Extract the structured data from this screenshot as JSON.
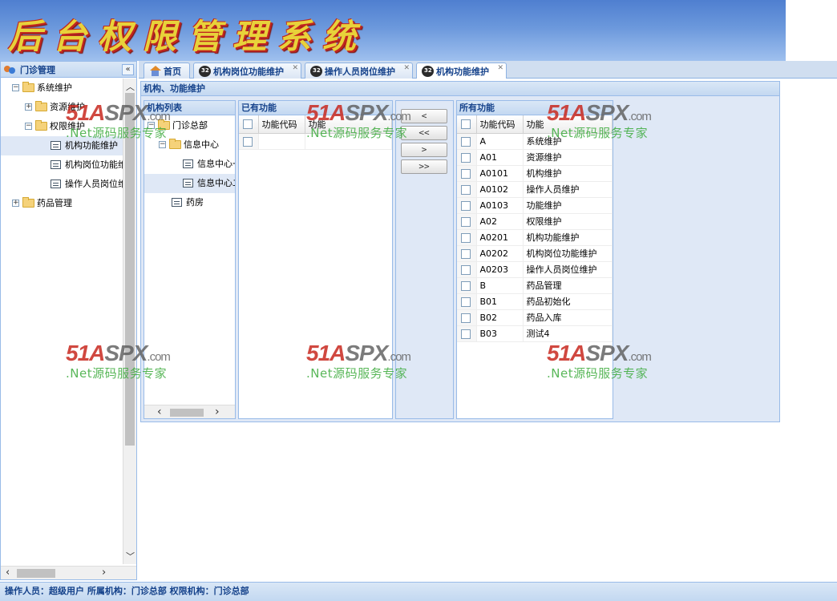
{
  "header": {
    "title": "后台权限管理系统"
  },
  "west": {
    "title": "门诊管理",
    "collapse_glyph": "«",
    "tree": [
      {
        "label": "系统维护",
        "type": "folder",
        "toggle": "−",
        "level": 0
      },
      {
        "label": "资源维护",
        "type": "folder",
        "toggle": "+",
        "level": 1
      },
      {
        "label": "权限维护",
        "type": "folder",
        "toggle": "−",
        "level": 1
      },
      {
        "label": "机构功能维护",
        "type": "leaf",
        "level": 2,
        "selected": true
      },
      {
        "label": "机构岗位功能维护",
        "type": "leaf",
        "level": 2
      },
      {
        "label": "操作人员岗位维护",
        "type": "leaf",
        "level": 2
      },
      {
        "label": "药品管理",
        "type": "folder",
        "toggle": "+",
        "level": 0
      }
    ]
  },
  "tabs": [
    {
      "label": "首页",
      "icon": "home-icon",
      "closable": false
    },
    {
      "label": "机构岗位功能维护",
      "icon": "gear-icon",
      "closable": true
    },
    {
      "label": "操作人员岗位维护",
      "icon": "gear-icon",
      "closable": true
    },
    {
      "label": "机构功能维护",
      "icon": "gear-icon",
      "closable": true,
      "active": true
    }
  ],
  "main": {
    "title": "机构、功能维护",
    "org_panel": {
      "title": "机构列表",
      "tree": [
        {
          "label": "门诊总部",
          "type": "folder",
          "toggle": "−",
          "level": 0
        },
        {
          "label": "信息中心",
          "type": "folder",
          "toggle": "−",
          "level": 1
        },
        {
          "label": "信息中心一",
          "type": "leaf",
          "level": 2
        },
        {
          "label": "信息中心二",
          "type": "leaf",
          "level": 2,
          "selected": true
        },
        {
          "label": "药房",
          "type": "leaf",
          "level": 1
        }
      ]
    },
    "existing_panel": {
      "title": "已有功能",
      "col_code": "功能代码",
      "col_name": "功能",
      "rows": [
        {
          "code": "",
          "name": ""
        }
      ]
    },
    "buttons": [
      "<",
      "<<",
      ">",
      ">>"
    ],
    "all_panel": {
      "title": "所有功能",
      "col_code": "功能代码",
      "col_name": "功能",
      "rows": [
        {
          "code": "A",
          "name": "系统维护"
        },
        {
          "code": "A01",
          "name": "资源维护"
        },
        {
          "code": "A0101",
          "name": "机构维护"
        },
        {
          "code": "A0102",
          "name": "操作人员维护"
        },
        {
          "code": "A0103",
          "name": "功能维护"
        },
        {
          "code": "A02",
          "name": "权限维护"
        },
        {
          "code": "A0201",
          "name": "机构功能维护"
        },
        {
          "code": "A0202",
          "name": "机构岗位功能维护"
        },
        {
          "code": "A0203",
          "name": "操作人员岗位维护"
        },
        {
          "code": "B",
          "name": "药品管理"
        },
        {
          "code": "B01",
          "name": "药品初始化"
        },
        {
          "code": "B02",
          "name": "药品入库"
        },
        {
          "code": "B03",
          "name": "测试4"
        }
      ]
    }
  },
  "status": {
    "text": "操作人员：超级用户   所属机构：门诊总部   权限机构：门诊总部"
  },
  "watermark": {
    "brand_a": "51A",
    "brand_x": "SPX",
    "brand_com": ".com",
    "tagline": ".Net源码服务专家"
  },
  "colors": {
    "panel_border": "#99bbe8",
    "header_text": "#15428b",
    "title_yellow": "#e8d23a",
    "title_red": "#c0251f"
  }
}
